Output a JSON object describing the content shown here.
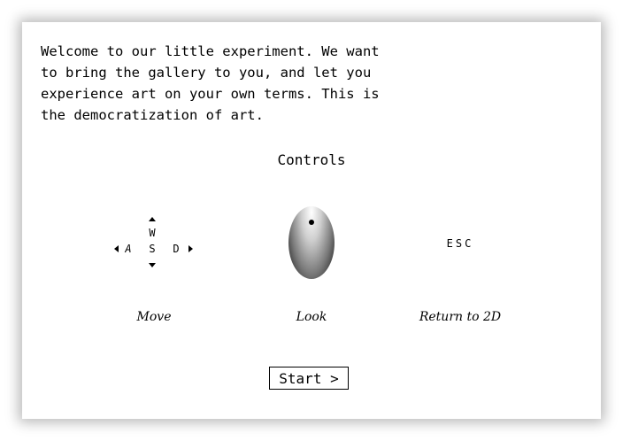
{
  "intro_text": "Welcome to our little experiment. We want\nto bring the gallery to you, and let you\nexperience art on your own terms. This is\nthe democratization of art.",
  "controls_title": "Controls",
  "controls": {
    "move": {
      "keys": {
        "up": "W",
        "left": "A",
        "center": "S",
        "right": "D"
      },
      "caption": "Move"
    },
    "look": {
      "icon": "mouse-icon",
      "caption": "Look"
    },
    "escape": {
      "keys": "ESC",
      "caption": "Return to 2D"
    }
  },
  "start_button_label": "Start >"
}
